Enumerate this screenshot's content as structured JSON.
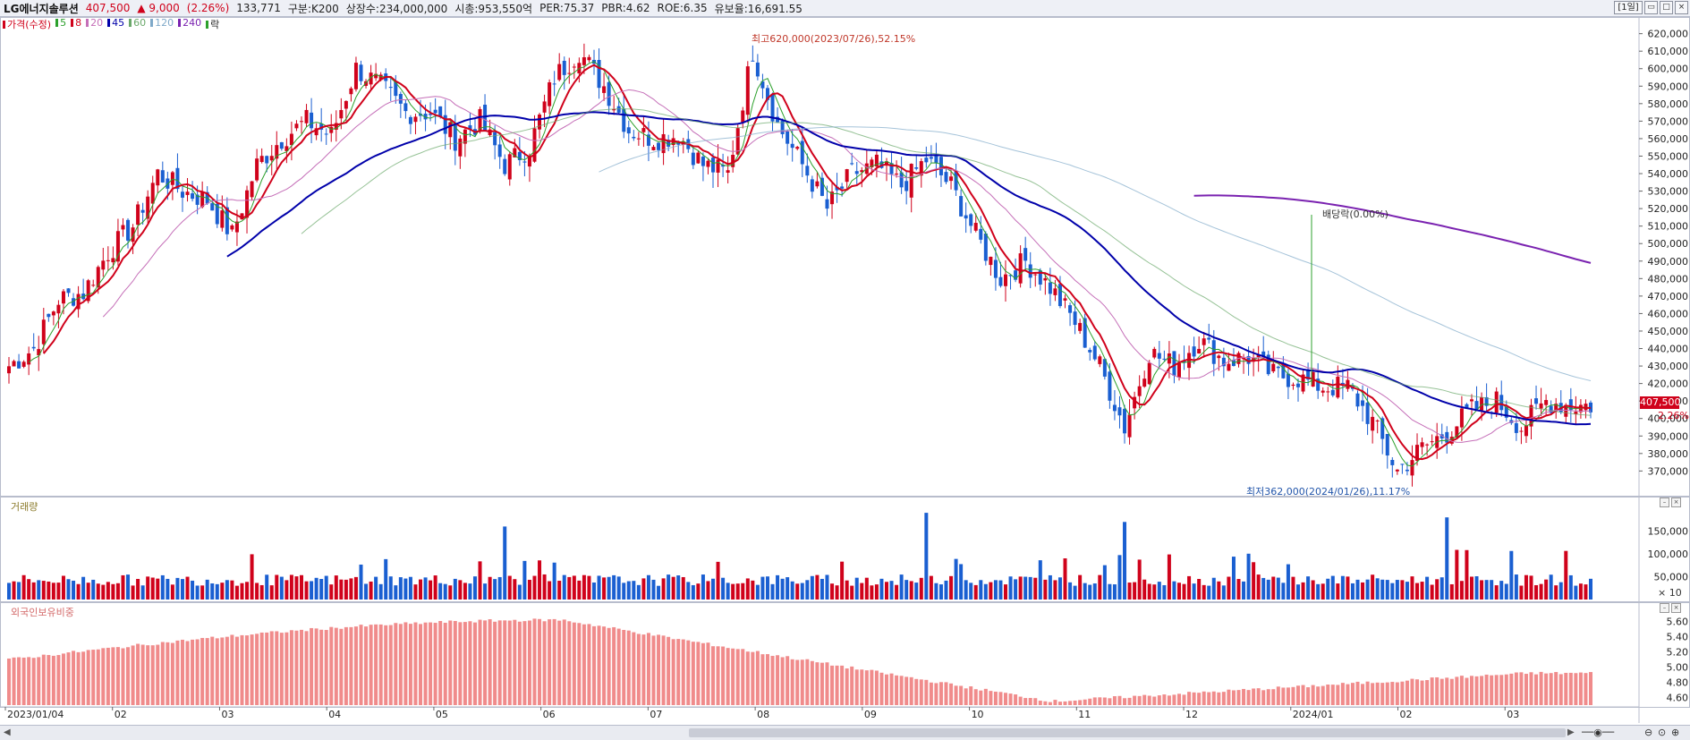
{
  "header": {
    "name": "LG에너지솔루션",
    "price": "407,500",
    "change": "▲ 9,000",
    "change_pct": "(2.26%)",
    "volume": "133,771",
    "segment": "구분:K200",
    "shares": "상장수:234,000,000",
    "mcap": "시총:953,550억",
    "per": "PER:75.37",
    "pbr": "PBR:4.62",
    "roe": "ROE:6.35",
    "float": "유보율:16,691.55",
    "period_button": "[1일]"
  },
  "legend": [
    {
      "label": "가격(수정)",
      "color": "#d0021b"
    },
    {
      "label": "5",
      "color": "#2ca02c"
    },
    {
      "label": "8",
      "color": "#d0021b"
    },
    {
      "label": "20",
      "color": "#c56fb8"
    },
    {
      "label": "45",
      "color": "#0000aa"
    },
    {
      "label": "60",
      "color": "#6aa86a"
    },
    {
      "label": "120",
      "color": "#7fa9c9"
    },
    {
      "label": "240",
      "color": "#7a22b0"
    },
    {
      "label": "락",
      "color": "#2ca02c"
    }
  ],
  "annotations": {
    "high": "최고620,000(2023/07/26),52.15%",
    "low": "최저362,000(2024/01/26),11.17%",
    "dividend": "배당락(0.00%)"
  },
  "price_axis": {
    "ticks": [
      "620,000",
      "610,000",
      "600,000",
      "590,000",
      "580,000",
      "570,000",
      "560,000",
      "550,000",
      "540,000",
      "530,000",
      "520,000",
      "510,000",
      "500,000",
      "490,000",
      "480,000",
      "470,000",
      "460,000",
      "450,000",
      "440,000",
      "430,000",
      "420,000",
      "410,000",
      "400,000",
      "390,000",
      "380,000",
      "370,000"
    ],
    "current_label": "407,500",
    "current_pct": "2.26%"
  },
  "volume_panel": {
    "title": "거래량",
    "ticks": [
      "150,000",
      "100,000",
      "50,000"
    ],
    "unit": "× 10"
  },
  "foreign_panel": {
    "title": "외국인보유비중",
    "ticks": [
      "5.60",
      "5.40",
      "5.20",
      "5.00",
      "4.80",
      "4.60"
    ]
  },
  "x_axis": {
    "labels": [
      "2023/01/04",
      "02",
      "03",
      "04",
      "05",
      "06",
      "07",
      "08",
      "09",
      "10",
      "11",
      "12",
      "2024/01",
      "02",
      "03"
    ]
  },
  "chart_data": {
    "type": "candlestick",
    "title": "LG에너지솔루션",
    "ylim": [
      362000,
      628000
    ],
    "weekly_closes": [
      430000,
      440000,
      468000,
      472000,
      495000,
      510000,
      540000,
      530000,
      525000,
      505000,
      545000,
      560000,
      570000,
      562000,
      600000,
      590000,
      575000,
      575000,
      560000,
      570000,
      545000,
      555000,
      595000,
      610000,
      590000,
      565000,
      560000,
      562000,
      545000,
      540000,
      610000,
      568000,
      545000,
      520000,
      540000,
      545000,
      533000,
      548000,
      533000,
      505000,
      480000,
      490000,
      475000,
      455000,
      430000,
      395000,
      438000,
      430000,
      445000,
      433000,
      435000,
      425000,
      423000,
      418000,
      418000,
      398000,
      370000,
      383000,
      392000,
      405000,
      410000,
      395000,
      410000,
      407500
    ],
    "series": [
      {
        "name": "5",
        "color": "#2ca02c"
      },
      {
        "name": "8",
        "color": "#d0021b"
      },
      {
        "name": "20",
        "color": "#c56fb8"
      },
      {
        "name": "45",
        "color": "#0000aa"
      },
      {
        "name": "60",
        "color": "#6aa86a"
      },
      {
        "name": "120",
        "color": "#7fa9c9"
      },
      {
        "name": "240",
        "color": "#7a22b0"
      }
    ],
    "volume_peaks": [
      {
        "week": 20,
        "value": 160000
      },
      {
        "week": 37,
        "value": 190000
      },
      {
        "week": 45,
        "value": 170000
      },
      {
        "week": 58,
        "value": 180000
      }
    ],
    "foreign_ownership": {
      "start": 5.1,
      "peak": 5.62,
      "trough": 4.55,
      "end": 4.92
    }
  }
}
